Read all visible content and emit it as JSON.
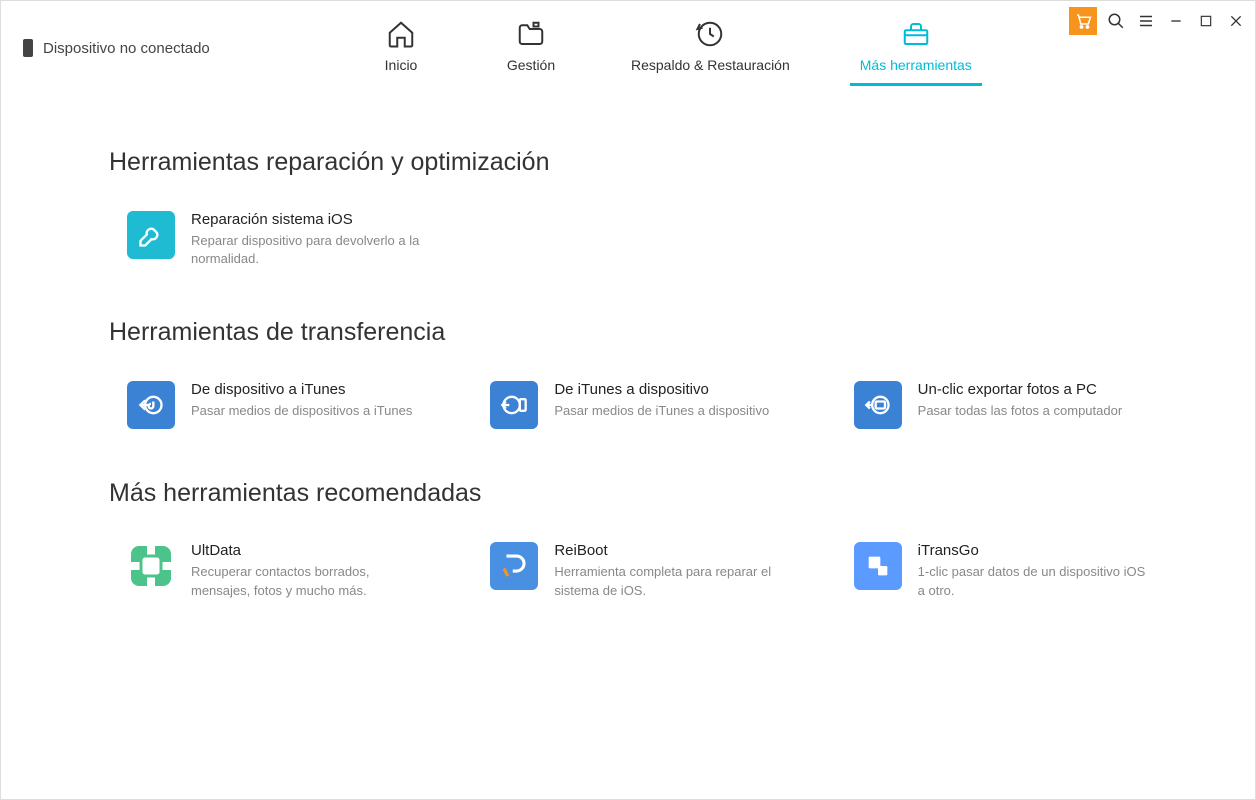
{
  "device_status": "Dispositivo no conectado",
  "nav": {
    "home": "Inicio",
    "manage": "Gestión",
    "backup": "Respaldo & Restauración",
    "tools": "Más herramientas"
  },
  "sections": {
    "repair": {
      "title": "Herramientas reparación y optimización",
      "items": [
        {
          "title": "Reparación sistema iOS",
          "desc": "Reparar dispositivo para devolverlo a la normalidad."
        }
      ]
    },
    "transfer": {
      "title": "Herramientas de transferencia",
      "items": [
        {
          "title": "De dispositivo a iTunes",
          "desc": "Pasar medios de dispositivos a iTunes"
        },
        {
          "title": "De iTunes a dispositivo",
          "desc": "Pasar medios de iTunes a dispositivo"
        },
        {
          "title": "Un-clic exportar fotos a PC",
          "desc": "Pasar todas las fotos a computador"
        }
      ]
    },
    "recommended": {
      "title": "Más herramientas recomendadas",
      "items": [
        {
          "title": "UltData",
          "desc": "Recuperar contactos borrados, mensajes, fotos y mucho más."
        },
        {
          "title": "ReiBoot",
          "desc": "Herramienta completa para reparar el sistema de iOS."
        },
        {
          "title": "iTransGo",
          "desc": "1-clic pasar datos de un dispositivo iOS a otro."
        }
      ]
    }
  }
}
